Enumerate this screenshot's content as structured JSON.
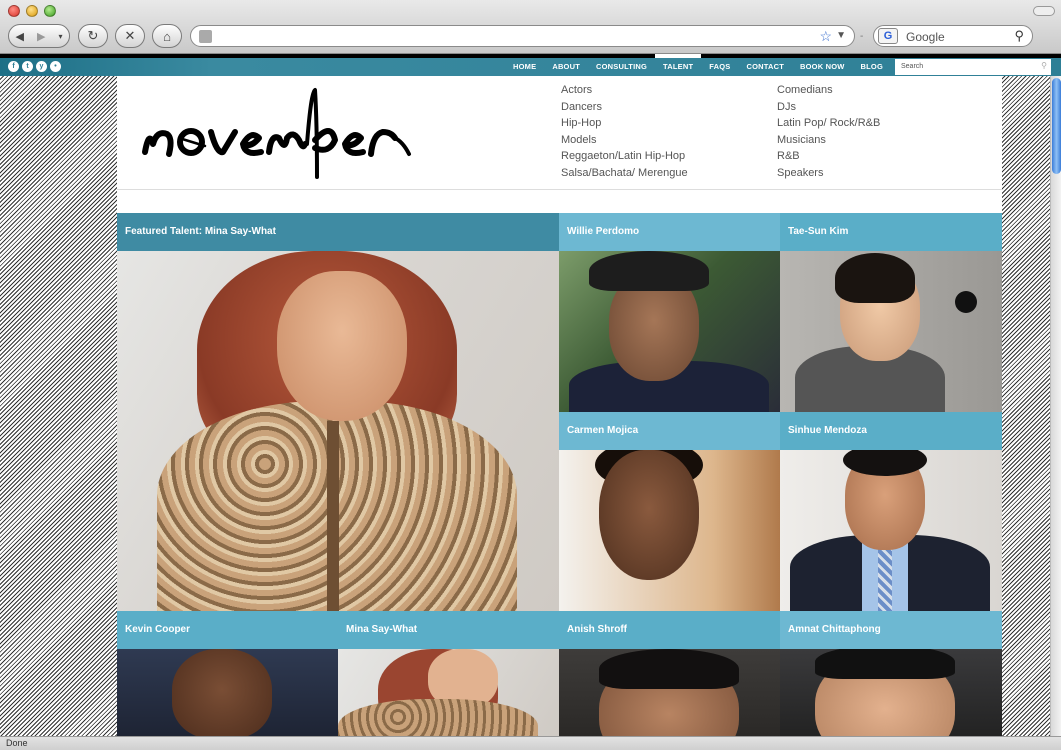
{
  "browser": {
    "url": "",
    "search_engine_label": "G",
    "search_placeholder": "Google",
    "status_text": "Done"
  },
  "site": {
    "social_icons": [
      "facebook-icon",
      "twitter-icon",
      "youtube-icon",
      "flickr-icon"
    ],
    "nav": [
      {
        "label": "HOME"
      },
      {
        "label": "ABOUT"
      },
      {
        "label": "CONSULTING"
      },
      {
        "label": "TALENT",
        "active": true
      },
      {
        "label": "FAQS"
      },
      {
        "label": "CONTACT"
      },
      {
        "label": "BOOK NOW"
      },
      {
        "label": "BLOG"
      }
    ],
    "search_placeholder": "Search",
    "logo_text": "november",
    "accent_color": "#5aaec8",
    "dark_accent_color": "#3f8ba3"
  },
  "categories": {
    "left": [
      "Actors",
      "Dancers",
      "Hip-Hop",
      "Models",
      "Reggaeton/Latin Hip-Hop",
      "Salsa/Bachata/ Merengue"
    ],
    "right": [
      "Comedians",
      "DJs",
      "Latin Pop/ Rock/R&B",
      "Musicians",
      "R&B",
      "Speakers"
    ]
  },
  "talent": {
    "featured": "Featured Talent: Mina Say-What",
    "willie": "Willie Perdomo",
    "tae": "Tae-Sun Kim",
    "carmen": "Carmen Mojica",
    "sinhue": "Sinhue Mendoza",
    "kevin": "Kevin Cooper",
    "mina": "Mina Say-What",
    "anish": "Anish Shroff",
    "amnat": "Amnat Chittaphong"
  }
}
